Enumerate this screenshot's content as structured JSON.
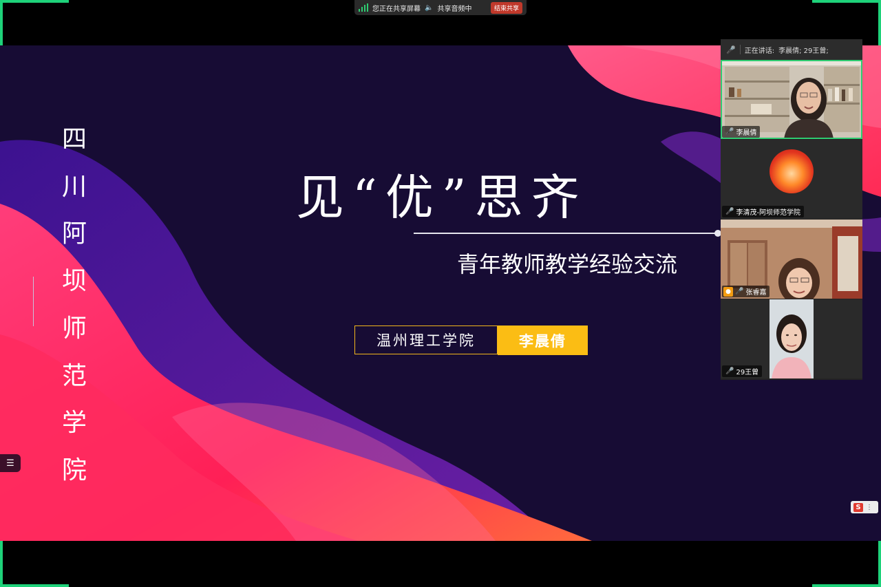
{
  "share_bar": {
    "status": "您正在共享屏幕",
    "audio": "共享音频中",
    "stop_label": "结束共享"
  },
  "slide": {
    "vertical_title": [
      "四",
      "川",
      "阿",
      "坝",
      "师",
      "范",
      "学",
      "院"
    ],
    "title": "见“优”思齐",
    "subtitle": "青年教师教学经验交流",
    "affiliation": "温州理工学院",
    "presenter": "李晨倩",
    "colors": {
      "background": "#170c34",
      "accent": "#fbbd14",
      "wave_pink": "#ff2d66",
      "wave_purple": "#5a1ea8"
    }
  },
  "panel": {
    "speaking_prefix": "正在讲话:",
    "speaking_names": "李晨倩; 29王曾;",
    "participants": [
      {
        "name": "李晨倩",
        "mic": "on",
        "active": true
      },
      {
        "name": "李清茂-阿坝师范学院",
        "mic": "muted",
        "active": false
      },
      {
        "name": "张睿嘉",
        "mic": "on",
        "active": false,
        "host": true
      },
      {
        "name": "29王曾",
        "mic": "on",
        "active": false
      }
    ]
  },
  "icons": {
    "signal": "signal-strength-icon",
    "speaker": "speaker-icon",
    "mic": "microphone-icon",
    "list": "list-icon",
    "host": "person-icon",
    "input_method": "sogou-s-icon"
  }
}
